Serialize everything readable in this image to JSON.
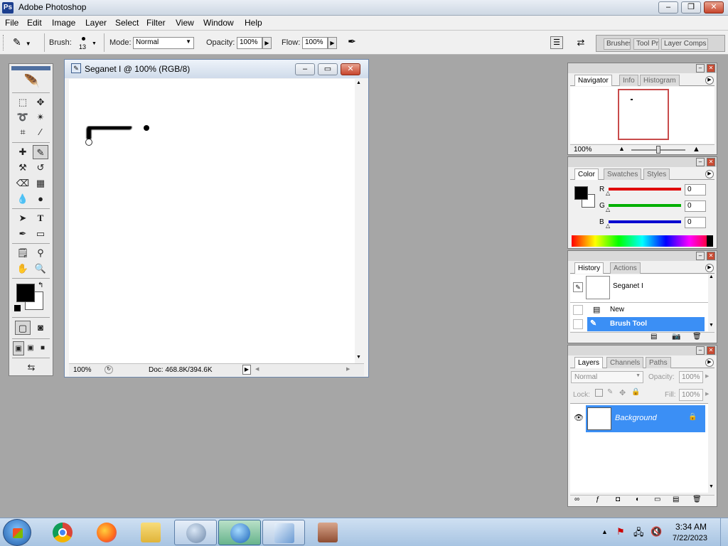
{
  "app": {
    "title": "Adobe Photoshop"
  },
  "menubar": {
    "items": [
      "File",
      "Edit",
      "Image",
      "Layer",
      "Select",
      "Filter",
      "View",
      "Window",
      "Help"
    ]
  },
  "options_bar": {
    "brush_label": "Brush:",
    "brush_size": "13",
    "mode_label": "Mode:",
    "mode_value": "Normal",
    "opacity_label": "Opacity:",
    "opacity_value": "100%",
    "flow_label": "Flow:",
    "flow_value": "100%",
    "well_tabs": [
      "Brushes",
      "Tool Pr",
      "Layer Comps"
    ]
  },
  "document": {
    "title": "Seganet I @ 100% (RGB/8)",
    "zoom": "100%",
    "doc_size": "Doc: 468.8K/394.6K"
  },
  "navigator_panel": {
    "tabs": [
      "Navigator",
      "Info",
      "Histogram"
    ],
    "zoom": "100%"
  },
  "color_panel": {
    "tabs": [
      "Color",
      "Swatches",
      "Styles"
    ],
    "channels": [
      {
        "label": "R",
        "value": "0",
        "color": "#e00000"
      },
      {
        "label": "G",
        "value": "0",
        "color": "#00b000"
      },
      {
        "label": "B",
        "value": "0",
        "color": "#0000d0"
      }
    ]
  },
  "history_panel": {
    "tabs": [
      "History",
      "Actions"
    ],
    "snapshot": "Seganet I",
    "items": [
      "New",
      "Brush Tool"
    ],
    "selected": "Brush Tool"
  },
  "layers_panel": {
    "tabs": [
      "Layers",
      "Channels",
      "Paths"
    ],
    "blend_mode": "Normal",
    "opacity_label": "Opacity:",
    "opacity_value": "100%",
    "lock_label": "Lock:",
    "fill_label": "Fill:",
    "fill_value": "100%",
    "layers": [
      {
        "name": "Background"
      }
    ]
  },
  "taskbar": {
    "time": "3:34 AM",
    "date": "7/22/2023"
  },
  "colors": {
    "selection_blue": "#3b8ff5",
    "foreground": "#000000",
    "background": "#ffffff",
    "workspace_gray": "#a6a6a6"
  }
}
